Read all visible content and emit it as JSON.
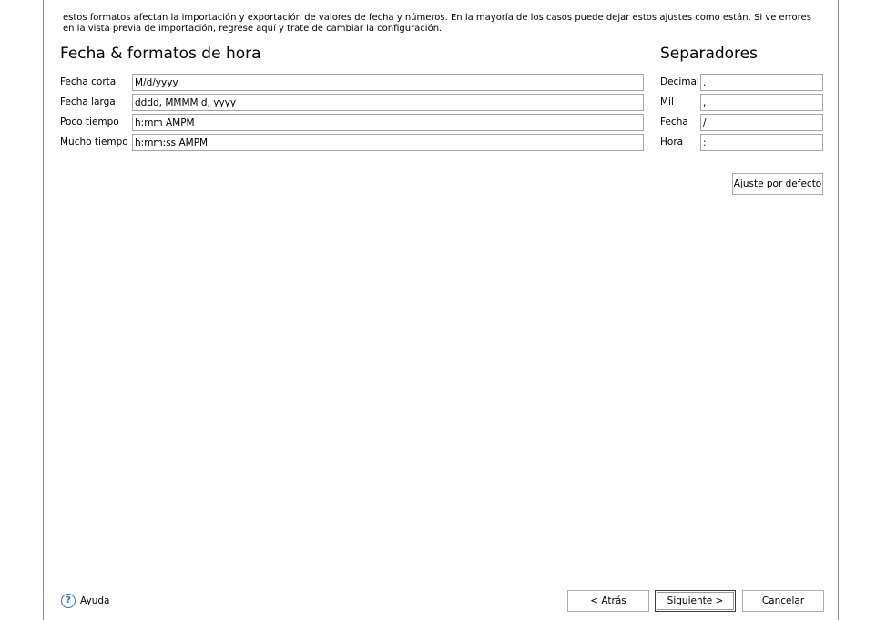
{
  "intro_text": "estos formatos afectan la importación y exportación de valores de fecha y números. En la mayoría de los casos puede dejar estos ajustes como están. Si ve errores\nen la vista previa de importación, regrese aquí y trate de cambiar la configuración.",
  "date_formats": {
    "title": "Fecha & formatos de hora",
    "rows": [
      {
        "label": "Fecha corta",
        "value": "M/d/yyyy"
      },
      {
        "label": "Fecha larga",
        "value": "dddd, MMMM d, yyyy"
      },
      {
        "label": "Poco tiempo",
        "value": "h:mm AMPM"
      },
      {
        "label": "Mucho tiempo",
        "value": "h:mm:ss AMPM"
      }
    ]
  },
  "separators": {
    "title": "Separadores",
    "rows": [
      {
        "label": "Decimal",
        "value": "."
      },
      {
        "label": "Mil",
        "value": ","
      },
      {
        "label": "Fecha",
        "value": "/"
      },
      {
        "label": "Hora",
        "value": ":"
      }
    ],
    "reset_button": "Ajuste por defecto"
  },
  "footer": {
    "help_icon": "help-circle-icon",
    "help_accel": "A",
    "help_rest": "yuda",
    "back_prefix": "< ",
    "back_accel": "A",
    "back_rest": "trás",
    "next_accel": "S",
    "next_rest": "iguiente >",
    "cancel_accel": "C",
    "cancel_rest": "ancelar"
  },
  "colors": {
    "help_icon": "#2a6fd6",
    "field_border": "#a6a6a6",
    "frame_border": "#8a8a8a"
  }
}
